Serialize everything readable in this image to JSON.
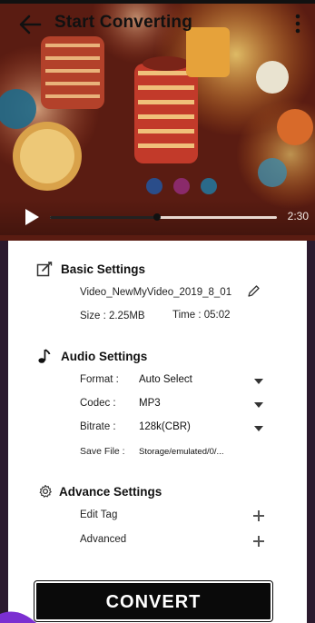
{
  "header": {
    "title": "Start Converting",
    "back_icon": "arrow-left-icon",
    "menu_icon": "more-vertical-icon"
  },
  "player": {
    "total_time": "2:30",
    "progress": 0.47,
    "play_icon": "play-icon"
  },
  "basic_settings": {
    "title": "Basic Settings",
    "icon": "edit-square-icon",
    "file_name": "Video_NewMyVideo_2019_8_01",
    "edit_icon": "pencil-icon",
    "size_text": "Size : 2.25MB",
    "time_text": "Time : 05:02"
  },
  "audio_settings": {
    "title": "Audio Settings",
    "icon": "music-note-icon",
    "rows": [
      {
        "label": "Format :",
        "value": "Auto Select"
      },
      {
        "label": "Codec :",
        "value": "MP3"
      },
      {
        "label": "Bitrate :",
        "value": "128k(CBR)"
      }
    ],
    "save_file_label": "Save File :",
    "save_file_value": "Storage/emulated/0/..."
  },
  "advance_settings": {
    "title": "Advance Settings",
    "icon": "gear-icon",
    "edit_tag": "Edit Tag",
    "advanced": "Advanced"
  },
  "convert_label": "CONVERT",
  "colors": {
    "button_bg": "#0a0a0a",
    "card_bg": "#ffffff",
    "accent_purple": "#7b2fd1"
  }
}
